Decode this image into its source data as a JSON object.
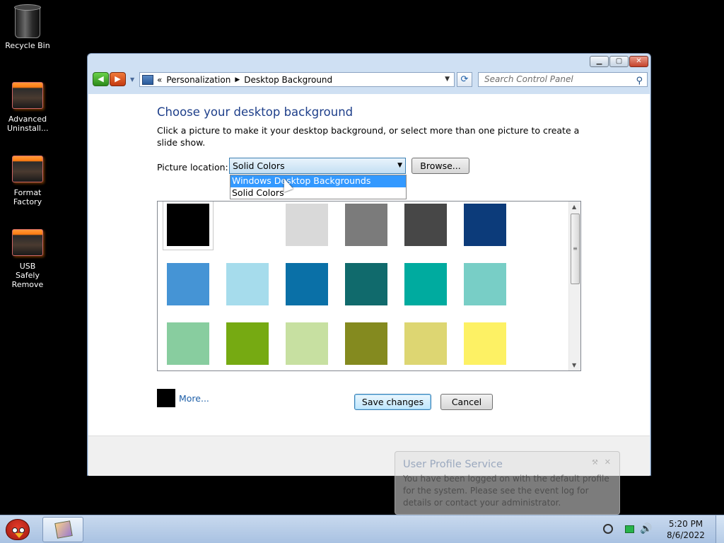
{
  "desktop": {
    "icons": [
      {
        "label": "Recycle Bin",
        "icon": "recycle-bin-icon"
      },
      {
        "label": "Advanced Uninstall...",
        "icon": "app-icon"
      },
      {
        "label": "Format Factory",
        "icon": "app-icon"
      },
      {
        "label": "USB Safely Remove",
        "icon": "app-icon"
      }
    ]
  },
  "window": {
    "controls": {
      "minimize": "▁",
      "maximize": "▢",
      "close": "✕"
    },
    "nav": {
      "back": "◀",
      "forward": "▶",
      "drop": "▼"
    },
    "breadcrumb": {
      "prefix": "«",
      "item1": "Personalization",
      "sep": "▶",
      "item2": "Desktop Background",
      "arrow": "▼"
    },
    "refresh": "⟳",
    "search": {
      "placeholder": "Search Control Panel",
      "icon": "⚲"
    }
  },
  "page": {
    "heading": "Choose your desktop background",
    "description": "Click a picture to make it your desktop background, or select more than one picture to create a slide show.",
    "location_label": "Picture location:",
    "location_value": "Solid Colors",
    "select_arrow": "▼",
    "browse": "Browse...",
    "dropdown_options": [
      "Windows Desktop Backgrounds",
      "Solid Colors"
    ],
    "swatches": [
      "#000000",
      "#ffffff",
      "#d9d9d9",
      "#7b7b7b",
      "#474747",
      "#0c3b7a",
      "#4594d5",
      "#a6dcec",
      "#0a70a7",
      "#106a6c",
      "#00ab9f",
      "#78cec6",
      "#88cd9f",
      "#76aa12",
      "#c7e0a1",
      "#848a1f",
      "#ddd672",
      "#fdf164"
    ],
    "scroll_up": "▲",
    "scroll_down": "▼",
    "scroll_grip": "≡",
    "more": "More...",
    "save": "Save changes",
    "cancel": "Cancel"
  },
  "notification": {
    "title": "User Profile Service",
    "text": "You have been logged on with the default profile for the system. Please see the event log for details or contact your administrator.",
    "options_icon": "⚒",
    "close": "✕"
  },
  "taskbar": {
    "time": "5:20 PM",
    "date": "8/6/2022",
    "volume": "🔊"
  }
}
